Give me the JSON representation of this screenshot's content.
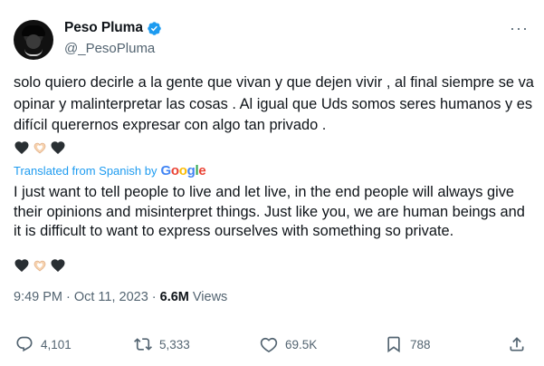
{
  "author": {
    "display_name": "Peso Pluma",
    "handle": "@_PesoPluma",
    "verified_icon": "verified-badge-icon",
    "verified_color": "#1d9bf0"
  },
  "more_icon": "more-horizontal-icon",
  "more_label": "···",
  "tweet": {
    "original_text": "solo quiero decirle a la gente que vivan y que dejen vivir , al final siempre se va opinar y malinterpretar las cosas . Al igual que Uds somos seres humanos y es difícil querernos expresar con algo tan privado .",
    "emojis": [
      "black-heart-icon",
      "heart-hands-icon",
      "black-heart-icon"
    ],
    "translation_label": "Translated from Spanish by",
    "translation_provider": "Google",
    "translated_text": "I just want to tell people to live and let live, in the end people will always give their opinions and misinterpret things. Just like you, we are human beings and it is difficult to want to express ourselves with something so private."
  },
  "meta": {
    "time": "9:49 PM",
    "separator": "·",
    "date": "Oct 11, 2023",
    "views_count": "6.6M",
    "views_label": "Views"
  },
  "actions": {
    "reply": {
      "icon": "reply-icon",
      "count": "4,101"
    },
    "retweet": {
      "icon": "retweet-icon",
      "count": "5,333"
    },
    "like": {
      "icon": "heart-outline-icon",
      "count": "69.5K"
    },
    "bookmark": {
      "icon": "bookmark-icon",
      "count": "788"
    },
    "share": {
      "icon": "share-icon"
    }
  },
  "colors": {
    "text_primary": "#0f1419",
    "text_secondary": "#536471",
    "link_blue": "#1d9bf0"
  }
}
